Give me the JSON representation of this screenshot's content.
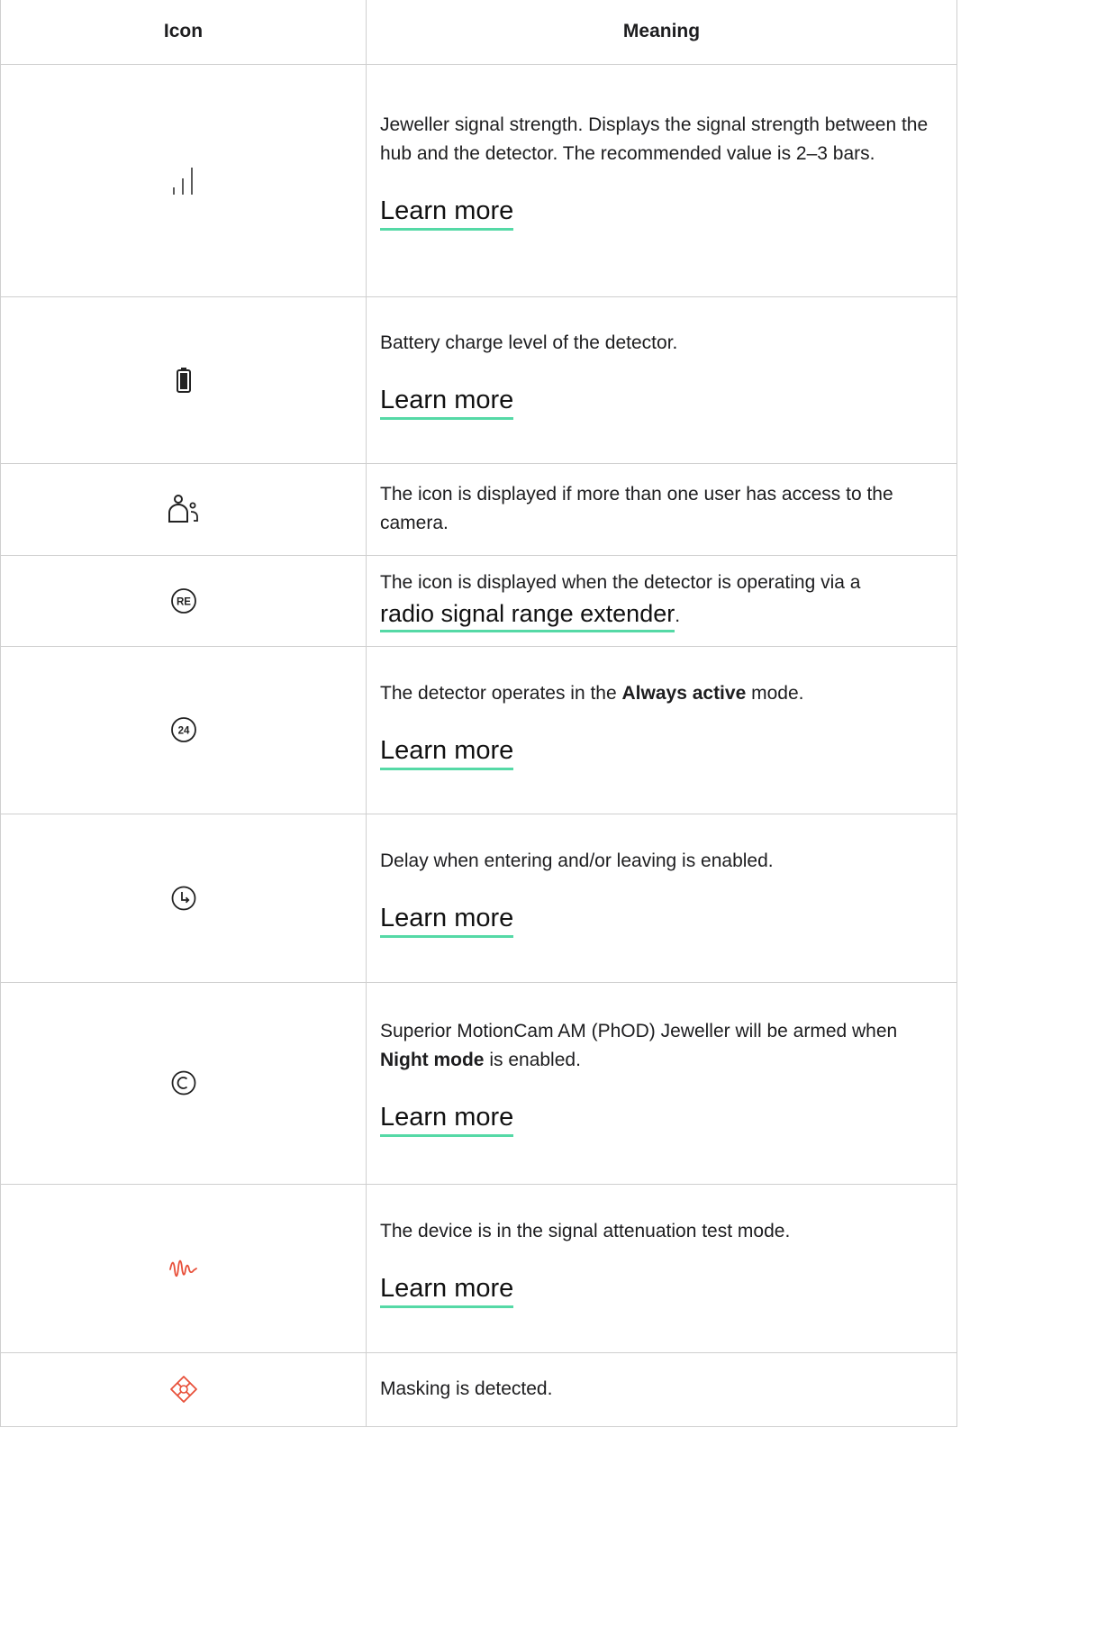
{
  "table": {
    "headers": {
      "icon": "Icon",
      "meaning": "Meaning"
    },
    "rows": [
      {
        "icon": "signal-strength-icon",
        "text": "Jeweller signal strength. Displays the signal strength between the hub and the detector. The recommended value is 2–3 bars.",
        "link": "Learn more"
      },
      {
        "icon": "battery-icon",
        "text": "Battery charge level of the detector.",
        "link": "Learn more"
      },
      {
        "icon": "users-icon",
        "text": "The icon is displayed if more than one user has access to the camera."
      },
      {
        "icon": "range-extender-icon",
        "icon_label": "RE",
        "text_before": "The icon is displayed when the detector is operating via a ",
        "link": "radio signal range extender",
        "text_after": "."
      },
      {
        "icon": "always-active-icon",
        "icon_label": "24",
        "text_before": "The detector operates in the ",
        "bold": "Always active",
        "text_after": " mode.",
        "link": "Learn more"
      },
      {
        "icon": "delay-icon",
        "text": "Delay when entering and/or leaving is enabled.",
        "link": "Learn more"
      },
      {
        "icon": "night-mode-icon",
        "text_before": "Superior MotionCam AM (PhOD) Jeweller will be armed when ",
        "bold": "Night mode",
        "text_after": " is enabled.",
        "link": "Learn more"
      },
      {
        "icon": "attenuation-test-icon",
        "text": "The device is in the signal attenuation test mode.",
        "link": "Learn more"
      },
      {
        "icon": "masking-icon",
        "text": "Masking is detected."
      }
    ]
  },
  "colors": {
    "accent_underline": "#55d9a6",
    "alert_icon": "#e8503a",
    "border": "#cfcfcf"
  }
}
